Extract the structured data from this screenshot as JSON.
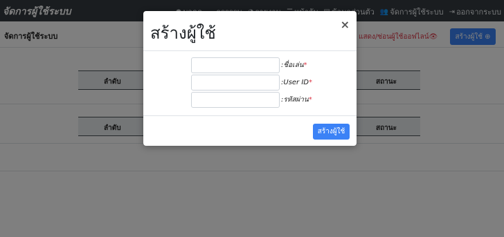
{
  "navbar": {
    "brand": "จัดการผู้ใช้ระบบ",
    "links": [
      {
        "label": "บอดด",
        "icon": "person-icon"
      },
      {
        "label": "ธรรรรม",
        "icon": "cloud-icon"
      },
      {
        "label": "รายงาน",
        "icon": "chart-pie-icon"
      },
      {
        "label": "หน้าจับ",
        "icon": "list-icon"
      },
      {
        "label": "ข้อมูลส่วนตัว",
        "icon": "id-card-icon"
      },
      {
        "label": "จัดการผู้ใช้ระบบ",
        "icon": "users-icon"
      },
      {
        "label": "ออกจากระบบ",
        "icon": "sign-out-icon"
      }
    ]
  },
  "page": {
    "title": "จัดการผู้ใช้ระบบ",
    "toggle_offline": "แสดง/ซ่อนผู้ใช้ออฟไลน์",
    "create_button": "สร้างผู้ใช้",
    "table_headers": {
      "seq": "ลำดับ",
      "status": "สถานะ"
    }
  },
  "modal": {
    "title": "สร้างผู้ใช้",
    "close": "×",
    "fields": [
      {
        "label": ":ชื่อเล่น",
        "required": "*",
        "value": ""
      },
      {
        "label": ":User ID",
        "required": "*",
        "value": ""
      },
      {
        "label": ":รหัสผ่าน",
        "required": "*",
        "value": ""
      }
    ],
    "submit": "สร้างผู้ใช้"
  },
  "colors": {
    "navbar": "#343a40",
    "primary": "#3b82f6",
    "danger": "#dc3545"
  }
}
